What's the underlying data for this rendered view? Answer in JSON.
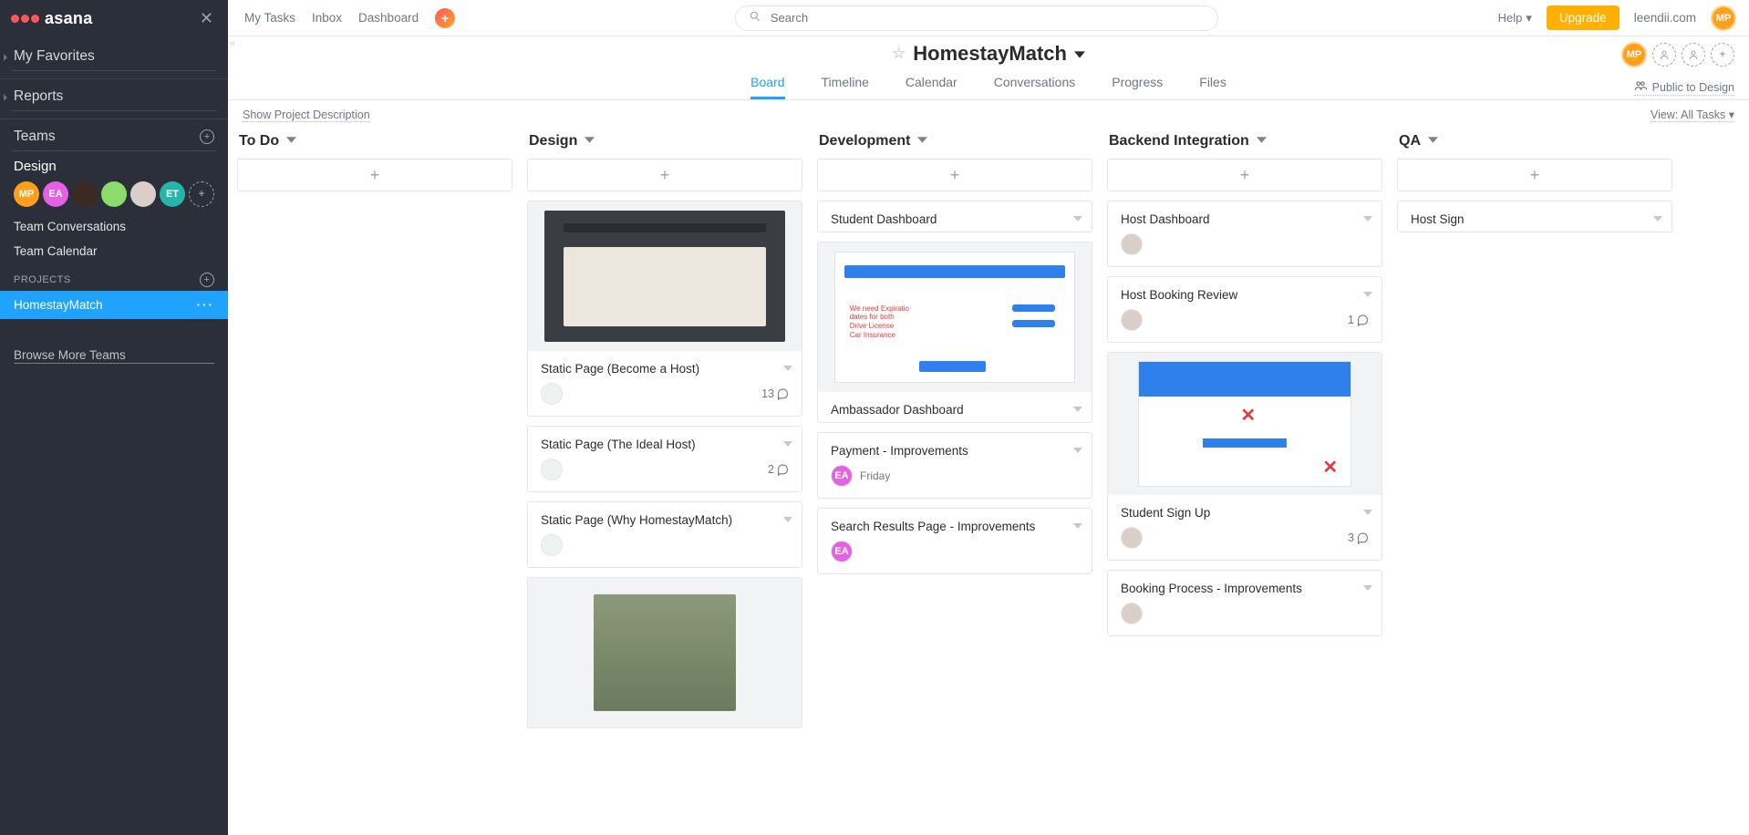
{
  "brand": "asana",
  "sidebar": {
    "favorites": "My Favorites",
    "reports": "Reports",
    "teams_label": "Teams",
    "team_name": "Design",
    "avatars": [
      {
        "text": "MP",
        "bg": "#ff9f1c"
      },
      {
        "text": "EA",
        "bg": "#e362e3"
      },
      {
        "text": "",
        "bg": "#3a2a22"
      },
      {
        "text": "",
        "bg": "#8bdc6a"
      },
      {
        "text": "",
        "bg": "#d9cfc8"
      },
      {
        "text": "ET",
        "bg": "#26b5a9"
      }
    ],
    "team_conversations": "Team Conversations",
    "team_calendar": "Team Calendar",
    "projects_label": "PROJECTS",
    "project": "HomestayMatch",
    "browse": "Browse More Teams"
  },
  "topbar": {
    "my_tasks": "My Tasks",
    "inbox": "Inbox",
    "dashboard": "Dashboard",
    "search_placeholder": "Search",
    "help": "Help",
    "upgrade": "Upgrade",
    "org": "leendii.com",
    "user_initials": "MP"
  },
  "project": {
    "title": "HomestayMatch",
    "tabs": [
      "Board",
      "Timeline",
      "Calendar",
      "Conversations",
      "Progress",
      "Files"
    ],
    "share": "Public to Design",
    "desc_link": "Show Project Description",
    "view_label": "View: All Tasks"
  },
  "columns": [
    {
      "name": "To Do",
      "cards": []
    },
    {
      "name": "Design",
      "cards": [
        {
          "title": "Static Page (Become a Host)",
          "cover": "cover1",
          "assignee": {
            "bg": "#eef3ef",
            "text": ""
          },
          "comments": 13
        },
        {
          "title": "Static Page (The Ideal Host)",
          "assignee": {
            "bg": "#eef3ef",
            "text": ""
          },
          "comments": 2
        },
        {
          "title": "Static Page (Why HomestayMatch)",
          "assignee": {
            "bg": "#eef3ef",
            "text": ""
          }
        },
        {
          "cover": "cover4"
        }
      ]
    },
    {
      "name": "Development",
      "cards": [
        {
          "title": "Student Dashboard"
        },
        {
          "title": "Ambassador Dashboard",
          "cover": "cover2"
        },
        {
          "title": "Payment - Improvements",
          "assignee": {
            "bg": "#e362e3",
            "text": "EA"
          },
          "due": "Friday"
        },
        {
          "title": "Search Results Page - Improvements",
          "assignee": {
            "bg": "#e362e3",
            "text": "EA"
          }
        }
      ]
    },
    {
      "name": "Backend Integration",
      "cards": [
        {
          "title": "Host Dashboard",
          "assignee": {
            "bg": "#d9cfc8",
            "text": ""
          }
        },
        {
          "title": "Host Booking Review",
          "assignee": {
            "bg": "#d9cfc8",
            "text": ""
          },
          "comments": 1
        },
        {
          "title": "Student Sign Up",
          "cover": "cover3",
          "assignee": {
            "bg": "#d9cfc8",
            "text": ""
          },
          "comments": 3
        },
        {
          "title": "Booking Process - Improvements",
          "assignee": {
            "bg": "#d9cfc8",
            "text": ""
          }
        }
      ]
    },
    {
      "name": "QA",
      "cards": [
        {
          "title": "Host Sign"
        }
      ]
    }
  ]
}
